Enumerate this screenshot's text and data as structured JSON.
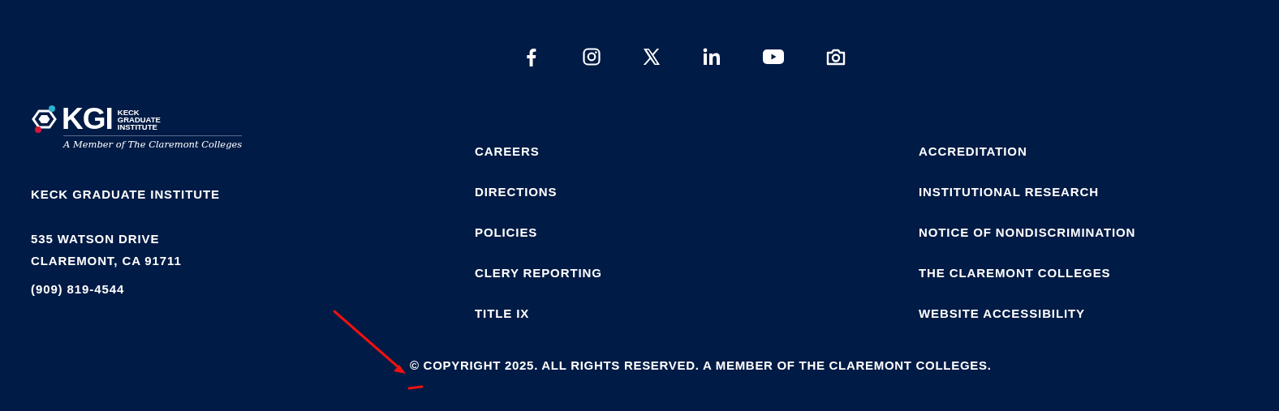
{
  "social_links": [
    {
      "kind": "facebook"
    },
    {
      "kind": "instagram"
    },
    {
      "kind": "x"
    },
    {
      "kind": "linkedin"
    },
    {
      "kind": "youtube"
    },
    {
      "kind": "camera"
    }
  ],
  "logo": {
    "initials": "KGI",
    "name_lines": [
      "KECK",
      "GRADUATE",
      "INSTITUTE"
    ],
    "tagline": "A Member of The Claremont Colleges"
  },
  "contact": {
    "name": "KECK GRADUATE INSTITUTE",
    "address_lines": [
      "535 WATSON DRIVE",
      "CLAREMONT, CA 91711"
    ],
    "phone": "(909) 819-4544"
  },
  "link_columns": [
    [
      "CAREERS",
      "DIRECTIONS",
      "POLICIES",
      "CLERY REPORTING",
      "TITLE IX"
    ],
    [
      "ACCREDITATION",
      "INSTITUTIONAL RESEARCH",
      "NOTICE OF NONDISCRIMINATION",
      "THE CLAREMONT COLLEGES",
      "WEBSITE ACCESSIBILITY"
    ]
  ],
  "copyright": "© COPYRIGHT 2025. ALL RIGHTS RESERVED. A MEMBER OF THE CLAREMONT COLLEGES.",
  "annotation": {
    "kind": "arrow"
  }
}
